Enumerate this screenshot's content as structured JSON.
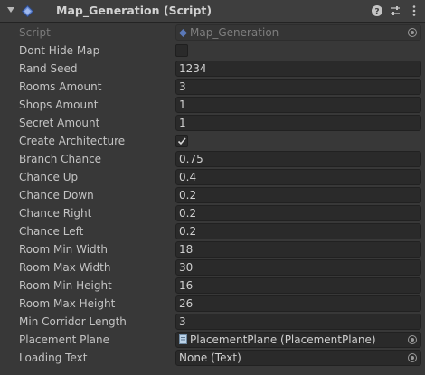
{
  "header": {
    "title": "Map_Generation (Script)"
  },
  "rows": [
    {
      "label": "Script",
      "value": "Map_Generation"
    },
    {
      "label": "Dont Hide Map",
      "checked": false
    },
    {
      "label": "Rand Seed",
      "value": "1234"
    },
    {
      "label": "Rooms Amount",
      "value": "3"
    },
    {
      "label": "Shops Amount",
      "value": "1"
    },
    {
      "label": "Secret Amount",
      "value": "1"
    },
    {
      "label": "Create Architecture",
      "checked": true
    },
    {
      "label": "Branch Chance",
      "value": "0.75"
    },
    {
      "label": "Chance Up",
      "value": "0.4"
    },
    {
      "label": "Chance Down",
      "value": "0.2"
    },
    {
      "label": "Chance Right",
      "value": "0.2"
    },
    {
      "label": "Chance Left",
      "value": "0.2"
    },
    {
      "label": "Room Min Width",
      "value": "18"
    },
    {
      "label": "Room Max Width",
      "value": "30"
    },
    {
      "label": "Room Min Height",
      "value": "16"
    },
    {
      "label": "Room Max Height",
      "value": "26"
    },
    {
      "label": "Min Corridor Length",
      "value": "3"
    },
    {
      "label": "Placement Plane",
      "value": "PlacementPlane (PlacementPlane)"
    },
    {
      "label": "Loading Text",
      "value": "None (Text)"
    }
  ],
  "colors": {
    "background": "#383838",
    "header": "#3e3e3e",
    "field": "#2a2a2a",
    "script_icon": "#6d8fd6"
  },
  "icons": [
    "fold-arrow-icon",
    "script-icon",
    "help-icon",
    "preset-icon",
    "more-options-icon",
    "object-picker-icon",
    "checkmark-icon",
    "gameobject-icon"
  ]
}
